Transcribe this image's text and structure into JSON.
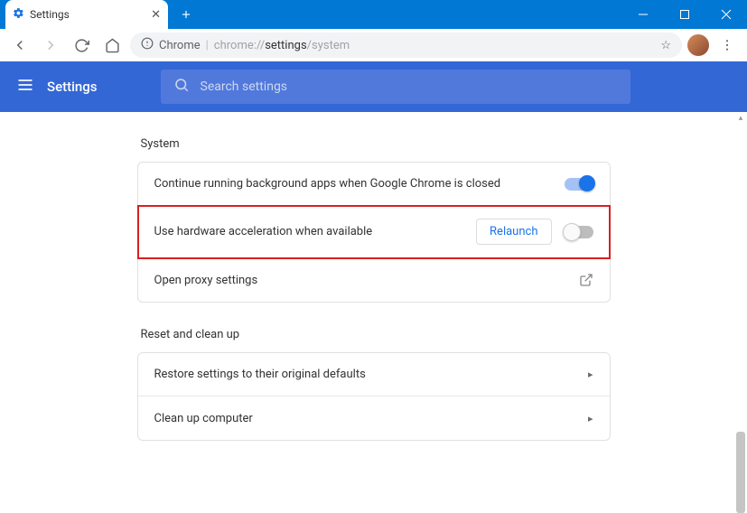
{
  "tab": {
    "title": "Settings"
  },
  "omnibox": {
    "secure_label": "Chrome",
    "url_scheme": "chrome://",
    "url_path_bold": "settings",
    "url_path_tail": "/system"
  },
  "appbar": {
    "title": "Settings",
    "search_placeholder": "Search settings"
  },
  "sections": {
    "system": {
      "title": "System",
      "rows": {
        "bg_apps": {
          "label": "Continue running background apps when Google Chrome is closed"
        },
        "hw_accel": {
          "label": "Use hardware acceleration when available",
          "relaunch": "Relaunch"
        },
        "proxy": {
          "label": "Open proxy settings"
        }
      }
    },
    "reset": {
      "title": "Reset and clean up",
      "rows": {
        "restore": {
          "label": "Restore settings to their original defaults"
        },
        "cleanup": {
          "label": "Clean up computer"
        }
      }
    }
  }
}
